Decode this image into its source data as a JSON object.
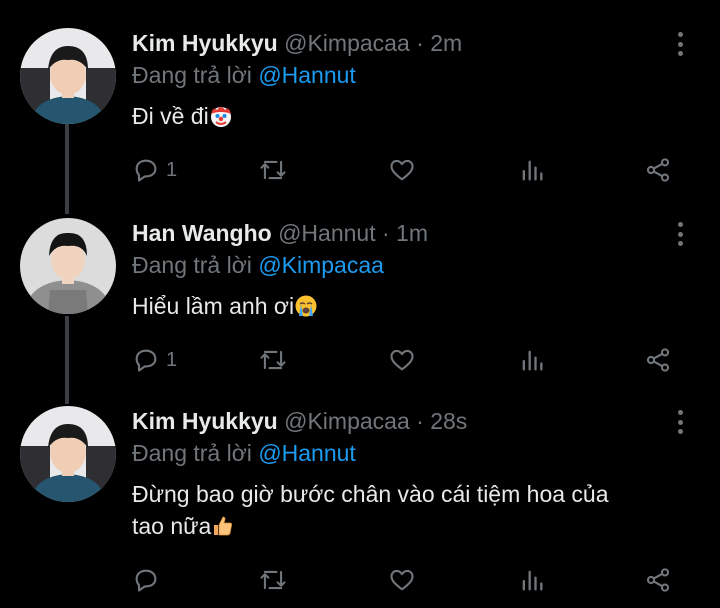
{
  "tweets": [
    {
      "name": "Kim Hyukkyu",
      "handle": "@Kimpacaa",
      "time": "2m",
      "reply_prefix": "Đang trả lời",
      "reply_to": "@Hannut",
      "text": "Đi về đi",
      "emoji": "clown-face-icon",
      "reply_count": "1"
    },
    {
      "name": "Han Wangho",
      "handle": "@Hannut",
      "time": "1m",
      "reply_prefix": "Đang trả lời",
      "reply_to": "@Kimpacaa",
      "text": "Hiểu lầm anh ơi",
      "emoji": "loudly-crying-face-icon",
      "reply_count": "1"
    },
    {
      "name": "Kim Hyukkyu",
      "handle": "@Kimpacaa",
      "time": "28s",
      "reply_prefix": "Đang trả lời",
      "reply_to": "@Hannut",
      "text_line1": "Đừng bao giờ bước chân vào cái tiệm hoa của",
      "text_line2": "tao nữa",
      "emoji": "thumbs-up-icon",
      "reply_count": ""
    }
  ],
  "separator": "·",
  "colors": {
    "background": "#000000",
    "text": "#e7e9ea",
    "secondary": "#71767b",
    "link": "#1d9bf0",
    "thread_line": "#3b3f43"
  }
}
